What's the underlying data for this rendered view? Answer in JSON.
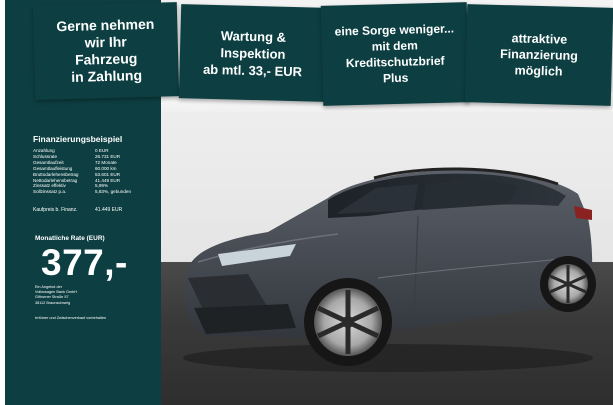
{
  "banners": [
    {
      "lines": [
        "Gerne nehmen",
        "wir Ihr",
        "Fahrzeug",
        "in Zahlung"
      ]
    },
    {
      "lines": [
        "Wartung &",
        "Inspektion",
        "ab mtl. 33,- EUR"
      ]
    },
    {
      "lines": [
        "eine Sorge weniger...",
        "mit dem",
        "Kreditschutzbrief",
        "Plus"
      ]
    },
    {
      "lines": [
        "attraktive",
        "Finanzierung",
        "möglich"
      ]
    }
  ],
  "finance": {
    "title": "Finanzierungsbeispiel",
    "rows": [
      {
        "label": "Anzahlung",
        "value": "0 EUR"
      },
      {
        "label": "Schlussrate",
        "value": "26.731 EUR"
      },
      {
        "label": "Gesamtlaufzeit",
        "value": "72 Monate"
      },
      {
        "label": "Gesamtlaufleistung",
        "value": "60.000 km"
      },
      {
        "label": "Bruttodarlehensbetrag",
        "value": "53.601 EUR"
      },
      {
        "label": "Nettodarlehensbetrag",
        "value": "41.449 EUR"
      },
      {
        "label": "Zinssatz effektiv",
        "value": "5,99%"
      },
      {
        "label": "Sollzinssatz p.a.",
        "value": "5,83%, gebunden"
      }
    ],
    "kaufpreis": {
      "label": "Kaufpreis b. Finanz.",
      "value": "41.449 EUR"
    },
    "rate_label": "Monatliche Rate (EUR)",
    "rate_value": "377,-",
    "lender_lines": [
      "Ein Angebot der",
      "Volkswagen Bank GmbH",
      "Gifhorner Straße 57",
      "38112 Braunschweig"
    ],
    "footnote": "Irrtümer und Zwischenverkauf vorbehalten"
  },
  "colors": {
    "panel": "#0d3f42",
    "car_body": "#4a4f57"
  }
}
